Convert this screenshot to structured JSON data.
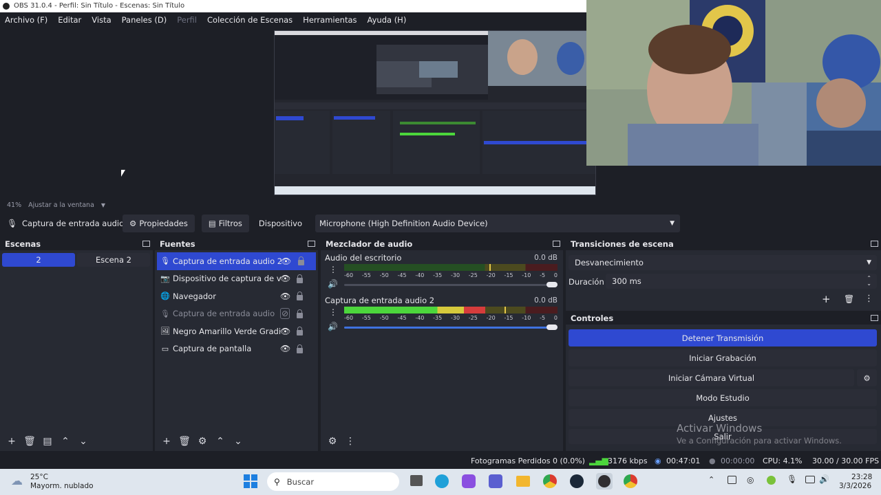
{
  "window_title": "OBS 31.0.4 - Perfil: Sin Título - Escenas: Sin Título",
  "menu": [
    "Archivo (F)",
    "Editar",
    "Vista",
    "Paneles (D)",
    "Perfil",
    "Colección de Escenas",
    "Herramientas",
    "Ayuda (H)"
  ],
  "zoom": {
    "percent": "41%",
    "fit_label": "Ajustar a la ventana"
  },
  "source_toolbar": {
    "source_name": "Captura de entrada audio 2",
    "properties": "Propiedades",
    "filters": "Filtros",
    "device_label": "Dispositivo",
    "device_value": "Microphone (High Definition Audio Device)"
  },
  "scenes": {
    "title": "Escenas",
    "items": [
      "2",
      "Escena 2"
    ],
    "active": 0
  },
  "sources": {
    "title": "Fuentes",
    "items": [
      {
        "label": "Captura de entrada audio 2",
        "icon": "mic-icon",
        "active": true,
        "visible": true
      },
      {
        "label": "Dispositivo de captura de video",
        "icon": "camera-icon",
        "active": false,
        "visible": true
      },
      {
        "label": "Navegador",
        "icon": "globe-icon",
        "active": false,
        "visible": true
      },
      {
        "label": "Captura de entrada audio",
        "icon": "mic-icon",
        "active": false,
        "visible": false
      },
      {
        "label": "Negro Amarillo Verde Gradiente",
        "icon": "image-icon",
        "active": false,
        "visible": true
      },
      {
        "label": "Captura de pantalla",
        "icon": "monitor-icon",
        "active": false,
        "visible": true
      }
    ]
  },
  "mixer": {
    "title": "Mezclador de audio",
    "ticks": [
      "-60",
      "-55",
      "-50",
      "-45",
      "-40",
      "-35",
      "-30",
      "-25",
      "-20",
      "-15",
      "-10",
      "-5",
      "0"
    ],
    "channels": [
      {
        "name": "Audio del escritorio",
        "db": "0.0 dB",
        "level": 0.0,
        "peak": 0.68,
        "volume": 1.0
      },
      {
        "name": "Captura de entrada audio 2",
        "db": "0.0 dB",
        "level": 0.66,
        "peak": 0.75,
        "volume": 1.0
      }
    ]
  },
  "transitions": {
    "title": "Transiciones de escena",
    "selected": "Desvanecimiento",
    "duration_label": "Duración",
    "duration_value": "300 ms"
  },
  "controls": {
    "title": "Controles",
    "buttons": [
      "Detener Transmisión",
      "Iniciar Grabación",
      "Iniciar Cámara Virtual",
      "Modo Estudio",
      "Ajustes",
      "Salir"
    ],
    "watermark_title": "Activar Windows",
    "watermark_sub": "Ve a Configuración para activar Windows."
  },
  "status": {
    "dropped": "Fotogramas Perdidos 0 (0.0%)",
    "bitrate": "3176 kbps",
    "stream_time": "00:47:01",
    "rec_time": "00:00:00",
    "cpu": "CPU: 4.1%",
    "fps": "30.00 / 30.00 FPS"
  },
  "taskbar": {
    "temp": "25°C",
    "weather": "Mayorm. nublado",
    "search_placeholder": "Buscar",
    "time": "23:28",
    "date": "3/3/2026"
  },
  "colors": {
    "accent": "#2f49d1",
    "panel": "#272a33",
    "bg": "#1d1f26",
    "button": "#2b2d37"
  }
}
